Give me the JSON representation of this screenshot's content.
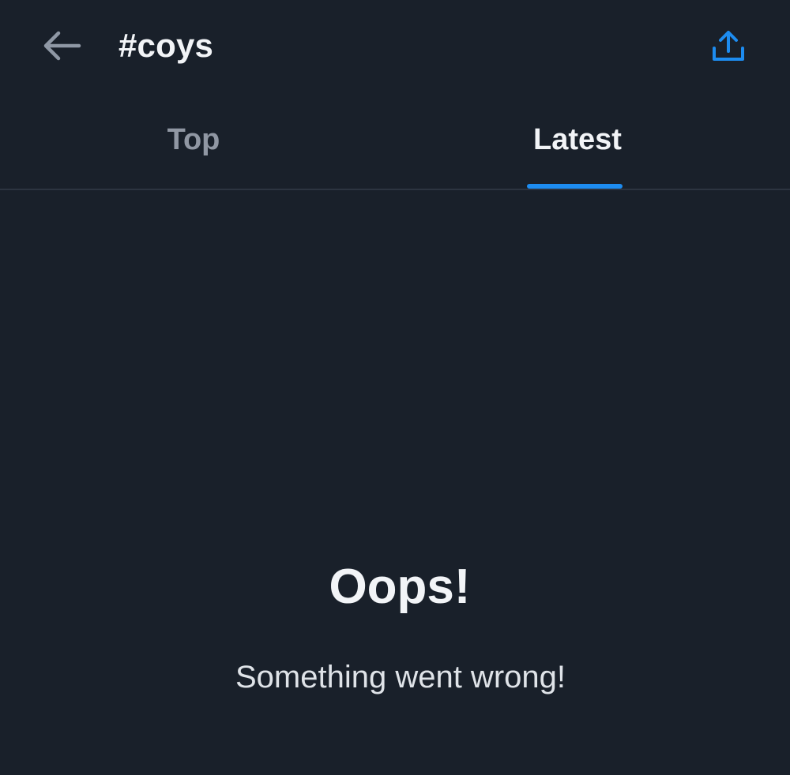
{
  "header": {
    "title": "#coys",
    "back_icon": "arrow-left-icon",
    "share_icon": "share-upload-icon"
  },
  "tabs": [
    {
      "label": "Top",
      "active": false
    },
    {
      "label": "Latest",
      "active": true
    }
  ],
  "error": {
    "title": "Oops!",
    "message": "Something went wrong!"
  },
  "colors": {
    "background": "#19202a",
    "accent": "#1d8cf0",
    "inactive_text": "#9097a3",
    "active_text": "#f2f4f7",
    "divider": "#2c3440"
  }
}
